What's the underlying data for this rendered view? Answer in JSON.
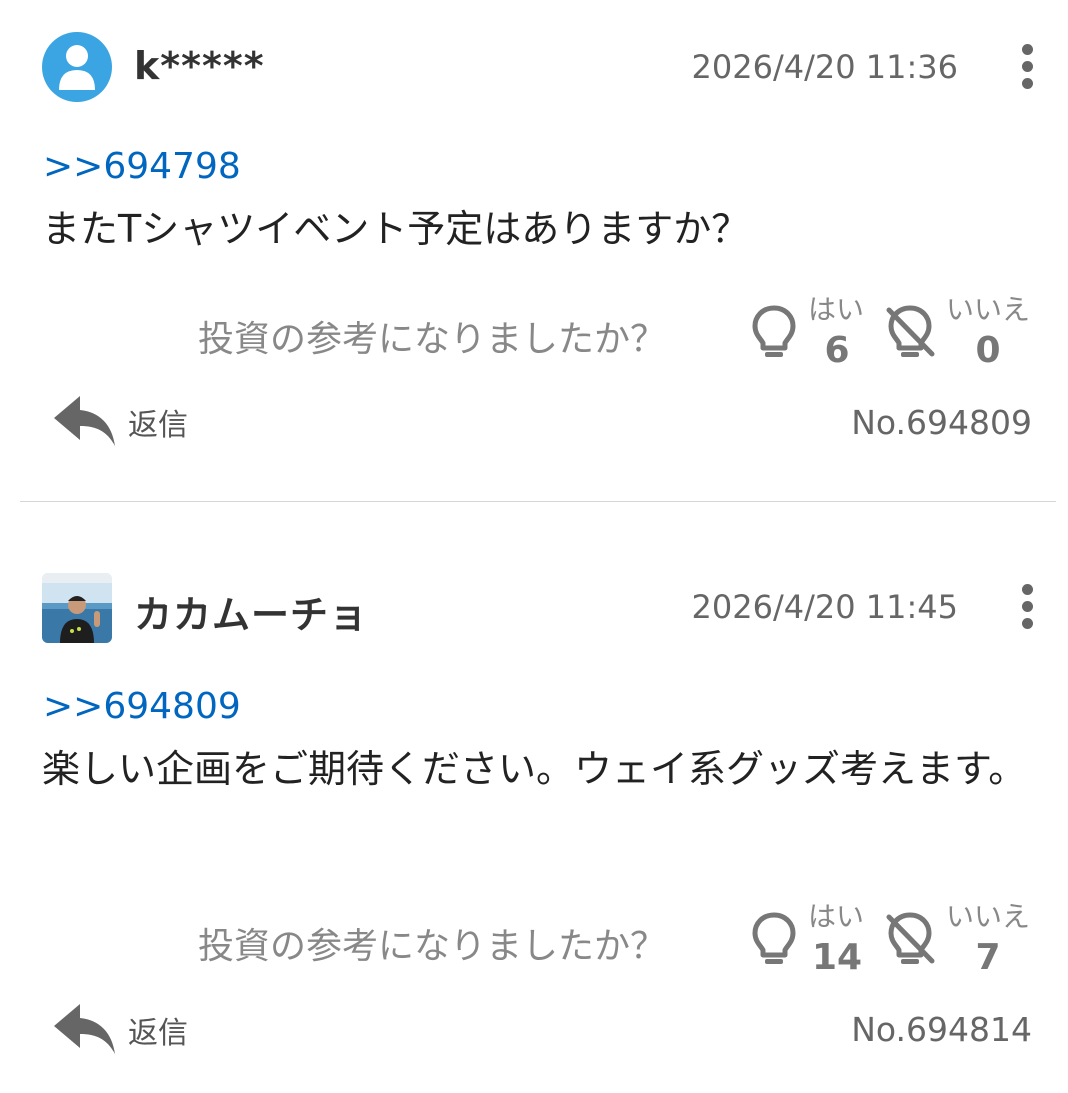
{
  "posts": [
    {
      "username": "k*****",
      "timestamp": "2026/4/20 11:36",
      "reply_ref": ">>694798",
      "body": "またTシャツイベント予定はありますか？",
      "vote_question": "投資の参考になりましたか？",
      "yes_label": "はい",
      "yes_count": "6",
      "no_label": "いいえ",
      "no_count": "0",
      "reply_label": "返信",
      "post_number": "No.694809"
    },
    {
      "username": "カカムーチョ",
      "timestamp": "2026/4/20 11:45",
      "reply_ref": ">>694809",
      "body": "楽しい企画をご期待ください。ウェイ系グッズ考えます。",
      "vote_question": "投資の参考になりましたか？",
      "yes_label": "はい",
      "yes_count": "14",
      "no_label": "いいえ",
      "no_count": "7",
      "reply_label": "返信",
      "post_number": "No.694814"
    }
  ],
  "icons": {
    "avatar_default": "person-icon",
    "menu": "kebab-menu-icon",
    "yes": "lightbulb-icon",
    "no": "lightbulb-off-icon",
    "reply": "reply-arrow-icon"
  },
  "colors": {
    "link": "#0066c0",
    "avatar_default_bg": "#3aa5e2",
    "muted_text": "#888888",
    "divider": "#d6d6d6"
  }
}
